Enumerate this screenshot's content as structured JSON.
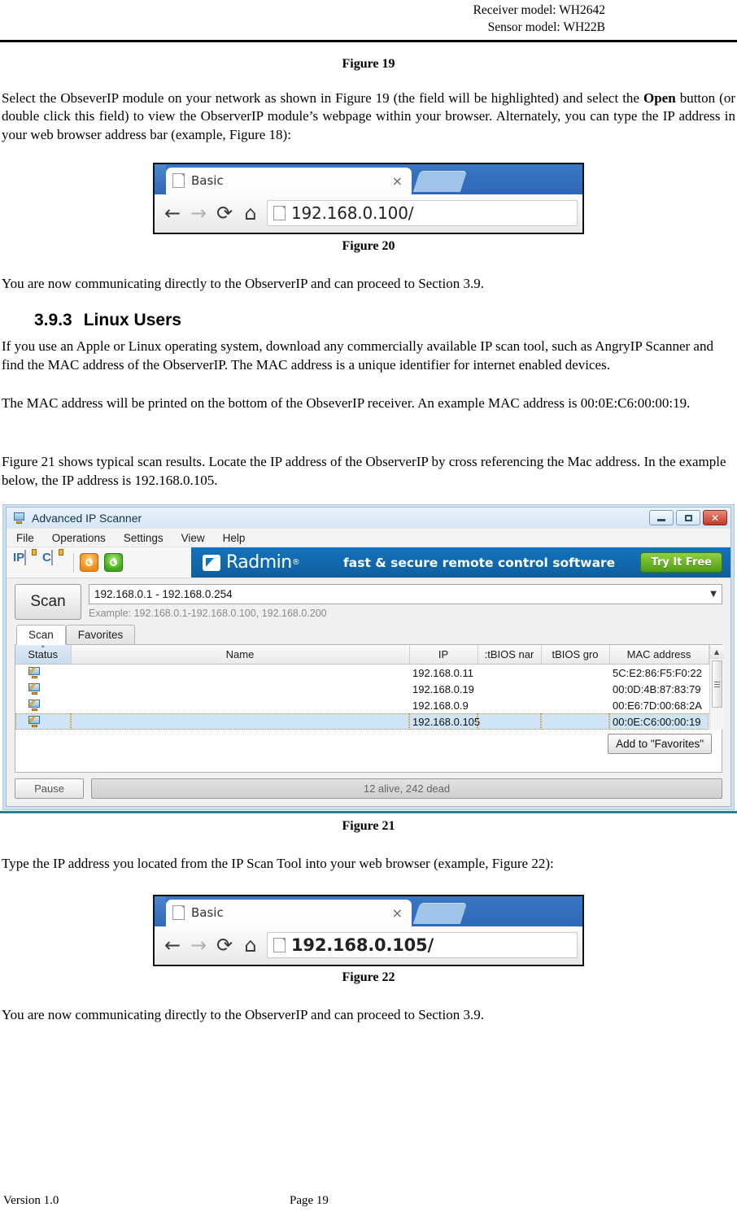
{
  "header": {
    "line1": "Receiver model: WH2642",
    "line2": "Sensor model: WH22B"
  },
  "captions": {
    "fig19": "Figure 19",
    "fig20": "Figure 20",
    "fig21": "Figure 21",
    "fig22": "Figure 22"
  },
  "paragraphs": {
    "p1_a": "Select the ObseverIP module on your network as shown in Figure 19 (the field will be highlighted) and select the ",
    "p1_bold": "Open",
    "p1_b": " button (or double click this field) to view the ObserverIP module’s webpage within your browser. Alternately, you can type the IP address in your web browser address bar (example, Figure 18):",
    "p2": "You are now communicating directly to the ObserverIP and can proceed to Section 3.9.",
    "p3": "If you use an Apple or Linux operating system, download any commercially available IP scan tool, such as AngryIP Scanner and find the MAC address of the ObserverIP. The MAC address is a unique identifier for internet enabled devices.",
    "p4": "The MAC address will be printed on the bottom of the ObseverIP receiver. An example MAC address is 00:0E:C6:00:00:19.",
    "p5": "Figure 21 shows typical scan results. Locate the IP address of the ObserverIP by cross referencing the Mac address. In the example below, the IP address is 192.168.0.105.",
    "p6": "Type the IP address you located from the IP Scan Tool into your web browser (example, Figure 22):",
    "p7": "You are now communicating directly to the ObserverIP and can proceed to Section 3.9."
  },
  "section": {
    "number": "3.9.3",
    "title": "Linux Users"
  },
  "browser20": {
    "tab_title": "Basic",
    "close": "×",
    "back": "←",
    "forward": "→",
    "reload": "⟳",
    "home": "⌂",
    "url": "192.168.0.100/"
  },
  "browser22": {
    "tab_title": "Basic",
    "close": "×",
    "back": "←",
    "forward": "→",
    "reload": "⟳",
    "home": "⌂",
    "url": "192.168.0.105/"
  },
  "scanner": {
    "window_title": "Advanced IP Scanner",
    "menu": [
      "File",
      "Operations",
      "Settings",
      "View",
      "Help"
    ],
    "toolbar": {
      "ip_label": "IP",
      "c_label": "C"
    },
    "banner": {
      "brand": "Radmin",
      "registered": "®",
      "tagline": "fast & secure remote control software",
      "cta": "Try It Free"
    },
    "scan_button": "Scan",
    "range_value": "192.168.0.1 - 192.168.0.254",
    "range_hint": "Example: 192.168.0.1-192.168.0.100, 192.168.0.200",
    "tabs": [
      {
        "label": "Scan",
        "active": true
      },
      {
        "label": "Favorites",
        "active": false
      }
    ],
    "columns": [
      "Status",
      "Name",
      "IP",
      ":tBIOS nar",
      "tBIOS gro",
      "MAC address"
    ],
    "rows": [
      {
        "name": "",
        "ip": "192.168.0.11",
        "netbios_name": "",
        "netbios_group": "",
        "mac": "5C:E2:86:F5:F0:22",
        "selected": false
      },
      {
        "name": "",
        "ip": "192.168.0.19",
        "netbios_name": "",
        "netbios_group": "",
        "mac": "00:0D:4B:87:83:79",
        "selected": false
      },
      {
        "name": "",
        "ip": "192.168.0.9",
        "netbios_name": "",
        "netbios_group": "",
        "mac": "00:E6:7D:00:68:2A",
        "selected": false
      },
      {
        "name": "",
        "ip": "192.168.0.105",
        "netbios_name": "",
        "netbios_group": "",
        "mac": "00:0E:C6:00:00:19",
        "selected": true
      }
    ],
    "add_favorites": "Add to \"Favorites\"",
    "pause": "Pause",
    "progress_text": "12 alive, 242 dead",
    "window_controls": {
      "minimize": "minimize",
      "maximize": "maximize",
      "close": "✕"
    }
  },
  "footer": {
    "version": "Version 1.0",
    "page": "Page 19"
  },
  "colors": {
    "radmin_blue": "#1273bd",
    "cta_green": "#4f9c14",
    "selection_blue": "#cfe4f7",
    "teal_rule": "#2e7d8c",
    "close_red": "#c0392b"
  }
}
